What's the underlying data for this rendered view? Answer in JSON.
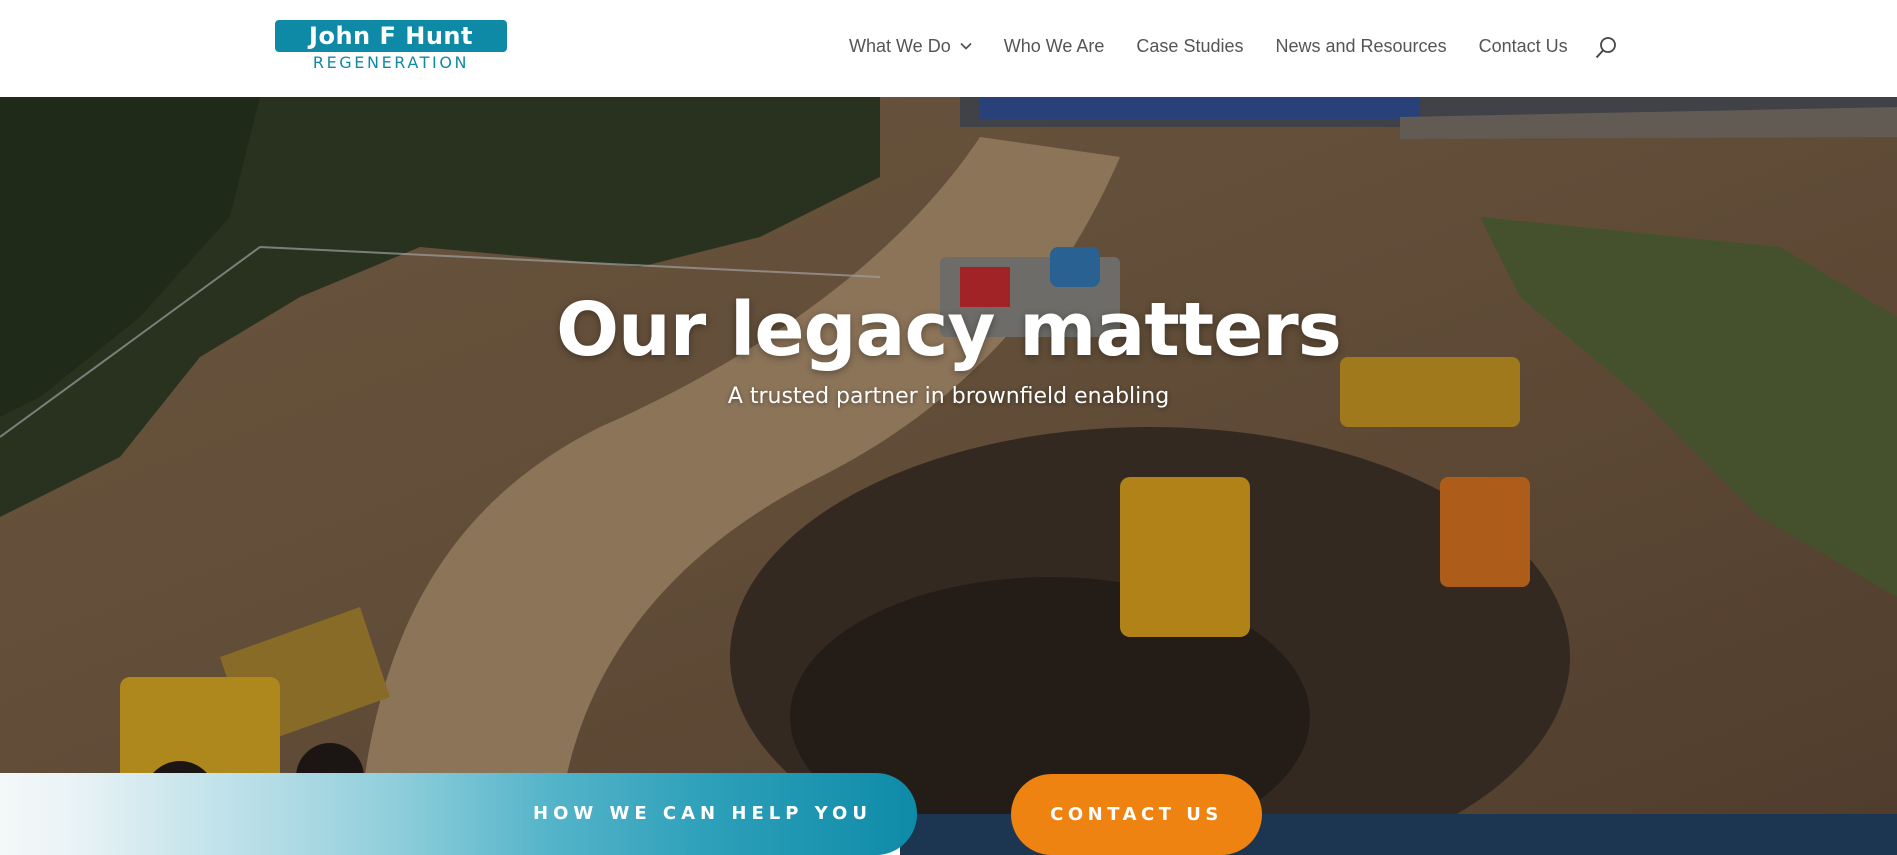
{
  "logo": {
    "line1": "John F Hunt",
    "line2": "REGENERATION"
  },
  "nav": {
    "items": [
      {
        "label": "What We Do",
        "has_dropdown": true
      },
      {
        "label": "Who We Are"
      },
      {
        "label": "Case Studies"
      },
      {
        "label": "News and Resources"
      },
      {
        "label": "Contact Us"
      }
    ],
    "search_icon": "search-icon"
  },
  "hero": {
    "title": "Our legacy matters",
    "subtitle": "A trusted partner in brownfield enabling"
  },
  "cta": {
    "help_label": "HOW WE CAN HELP YOU",
    "contact_label": "CONTACT US"
  },
  "colors": {
    "brand_teal": "#0f8aa6",
    "accent_orange": "#ee8312",
    "navy_band": "#1c3550",
    "nav_text": "#555555"
  }
}
